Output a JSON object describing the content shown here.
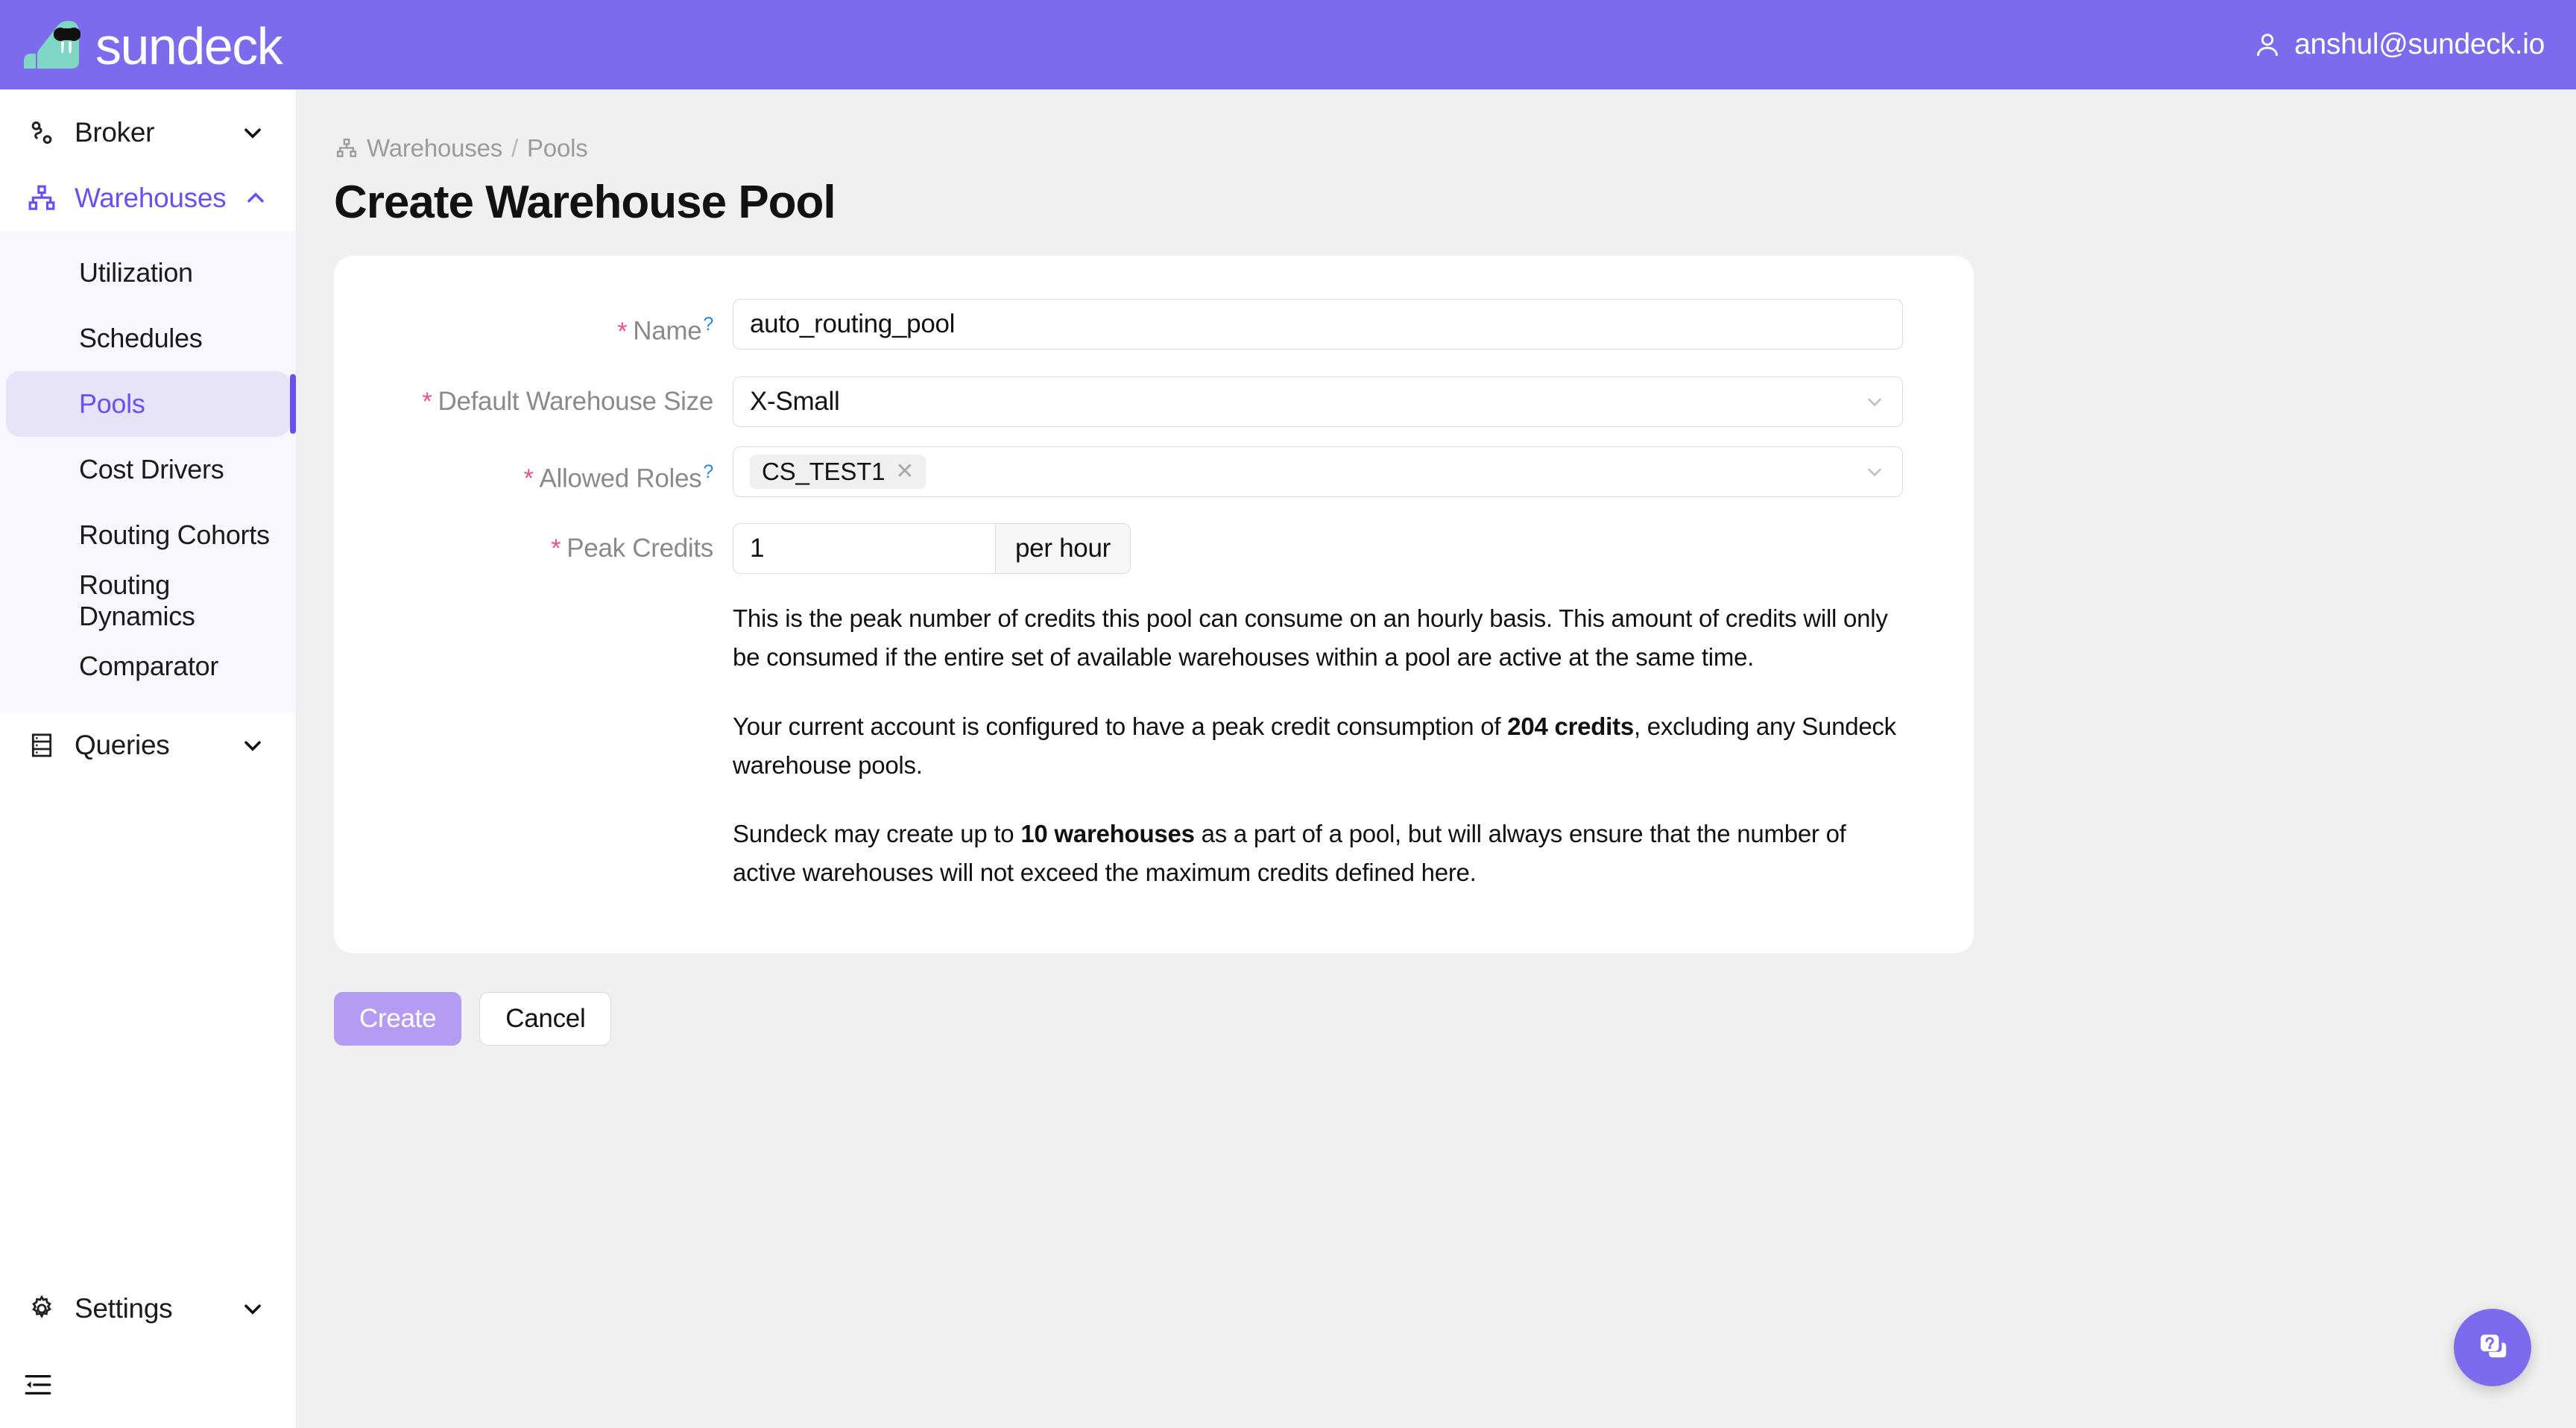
{
  "header": {
    "brand_name": "sundeck",
    "brand_logo_icon": "walrus-sunglasses-logo",
    "account_icon": "user-icon",
    "account_email": "anshul@sundeck.io",
    "bar_color": "#7c6ced"
  },
  "sidebar": {
    "groups": [
      {
        "label": "Broker",
        "icon": "route-icon",
        "chevron": "chevron-down-icon",
        "expanded": false,
        "active": false
      },
      {
        "label": "Warehouses",
        "icon": "hierarchy-icon",
        "chevron": "chevron-up-icon",
        "expanded": true,
        "active": true
      },
      {
        "label": "Queries",
        "icon": "database-rows-icon",
        "chevron": "chevron-down-icon",
        "expanded": false,
        "active": false
      }
    ],
    "warehouses_items": [
      {
        "label": "Utilization",
        "selected": false
      },
      {
        "label": "Schedules",
        "selected": false
      },
      {
        "label": "Pools",
        "selected": true
      },
      {
        "label": "Cost Drivers",
        "selected": false
      },
      {
        "label": "Routing Cohorts",
        "selected": false
      },
      {
        "label": "Routing Dynamics",
        "selected": false
      },
      {
        "label": "Comparator",
        "selected": false
      }
    ],
    "settings": {
      "label": "Settings",
      "icon": "gear-icon",
      "chevron": "chevron-down-icon"
    },
    "collapse_icon": "sidebar-collapse-icon",
    "accent_color": "#6c4ff0",
    "submenu_bg": "#f8f6fe"
  },
  "breadcrumb": {
    "icon": "hierarchy-icon",
    "items": [
      "Warehouses",
      "Pools"
    ],
    "separator": "/"
  },
  "page": {
    "title": "Create Warehouse Pool"
  },
  "form": {
    "name": {
      "label": "Name",
      "required_mark": "*",
      "help_mark": "?",
      "value": "auto_routing_pool",
      "placeholder": ""
    },
    "default_warehouse_size": {
      "label": "Default Warehouse Size",
      "required_mark": "*",
      "value": "X-Small",
      "chevron": "chevron-down-icon"
    },
    "allowed_roles": {
      "label": "Allowed Roles",
      "required_mark": "*",
      "help_mark": "?",
      "tags": [
        "CS_TEST1"
      ],
      "tag_remove_icon": "close-icon",
      "chevron": "chevron-down-icon"
    },
    "peak_credits": {
      "label": "Peak Credits",
      "required_mark": "*",
      "value": "1",
      "unit_addon": "per hour"
    },
    "help_paragraphs": [
      {
        "before": "This is the peak number of credits this pool can consume on an hourly basis. This amount of credits will only be consumed if the entire set of available warehouses within a pool are active at the same time.",
        "strong": "",
        "after": ""
      },
      {
        "before": "Your current account is configured to have a peak credit consumption of ",
        "strong": "204 credits",
        "after": ", excluding any Sundeck warehouse pools."
      },
      {
        "before": "Sundeck may create up to ",
        "strong": "10 warehouses",
        "after": " as a part of a pool, but will always ensure that the number of active warehouses will not exceed the maximum credits defined here."
      }
    ]
  },
  "actions": {
    "create_label": "Create",
    "cancel_label": "Cancel",
    "create_color": "#b49cf5"
  },
  "help_fab": {
    "icon": "help-cards-icon",
    "color": "#7c6ced"
  }
}
